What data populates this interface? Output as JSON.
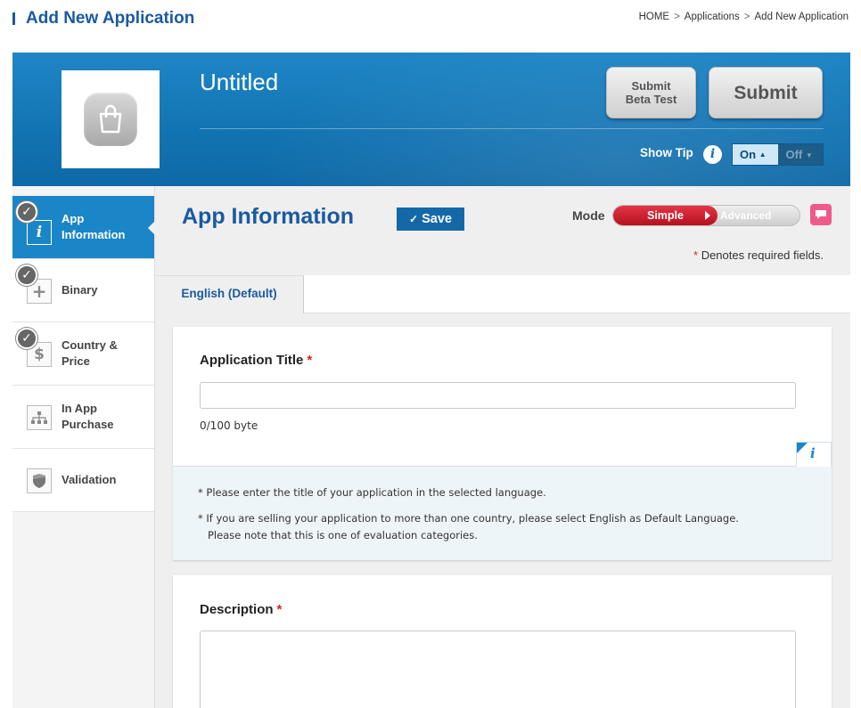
{
  "header": {
    "page_title": "Add New Application",
    "breadcrumb": [
      "HOME",
      "Applications",
      "Add New Application"
    ],
    "breadcrumb_sep": ">"
  },
  "hero": {
    "app_name": "Untitled",
    "submit_beta_line1": "Submit",
    "submit_beta_line2": "Beta Test",
    "submit_label": "Submit",
    "show_tip_label": "Show Tip",
    "tip_icon": "i",
    "toggle_on": "On",
    "toggle_off": "Off"
  },
  "sidebar": {
    "items": [
      {
        "line1": "App",
        "line2": "Information",
        "icon": "info-icon",
        "checked": true,
        "active": true
      },
      {
        "line1": "Binary",
        "line2": "",
        "icon": "plus-icon",
        "checked": true,
        "active": false
      },
      {
        "line1": "Country &",
        "line2": "Price",
        "icon": "dollar-icon",
        "checked": true,
        "active": false
      },
      {
        "line1": "In App",
        "line2": "Purchase",
        "icon": "hierarchy-icon",
        "checked": false,
        "active": false
      },
      {
        "line1": "Validation",
        "line2": "",
        "icon": "shield-icon",
        "checked": false,
        "active": false
      }
    ]
  },
  "main": {
    "section_title": "App Information",
    "save_label": "Save",
    "mode_label": "Mode",
    "mode_simple": "Simple",
    "mode_advanced": "Advanced",
    "required_star": "*",
    "required_note": "Denotes required fields.",
    "tab_label": "English (Default)",
    "title_field": {
      "label": "Application Title",
      "value": "",
      "byte_count": "0/100 byte"
    },
    "tips": [
      "* Please enter the title of your application in the selected language.",
      "* If you are selling your application to more than one country, please select English as Default Language.",
      "Please note that this is one of evaluation categories."
    ],
    "description_field": {
      "label": "Description",
      "value": ""
    }
  },
  "colors": {
    "brand_blue": "#1a5aa0",
    "hero_blue": "#1273b2",
    "active_blue": "#1b86c7",
    "required_red": "#e02020",
    "mode_red": "#c8192a",
    "chat_pink": "#ee5b8b"
  }
}
